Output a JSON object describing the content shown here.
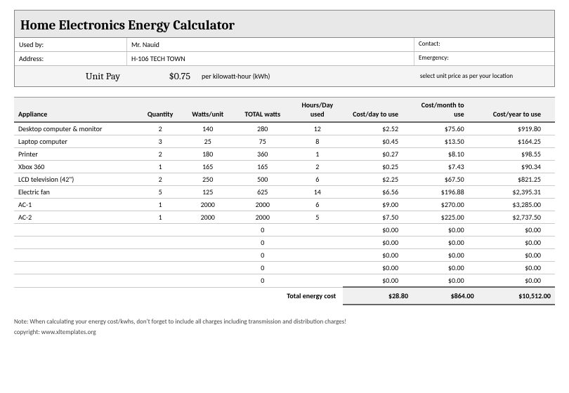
{
  "title": "Home Electronics Energy Calculator",
  "info": {
    "used_by_label": "Used by:",
    "used_by_value": "Mr. Nauid",
    "address_label": "Address:",
    "address_value": "H-106 TECH TOWN",
    "contact_label": "Contact:",
    "emergency_label": "Emergency:"
  },
  "unit_pay": {
    "label": "Unit Pay",
    "value": "$0.75",
    "unit": "per kilowatt-hour (kWh)",
    "note": "select unit price as per your location"
  },
  "columns": {
    "appliance": "Appliance",
    "quantity": "Quantity",
    "watts_unit": "Watts/unit",
    "total_watts": "TOTAL  watts",
    "hours_day": "Hours/Day used",
    "cost_day": "Cost/day to use",
    "cost_month": "Cost/month to use",
    "cost_year": "Cost/year to use"
  },
  "rows": [
    {
      "appliance": "Desktop computer & monitor",
      "quantity": "2",
      "watts_unit": "140",
      "total_watts": "280",
      "hours_day": "12",
      "cost_day": "$2.52",
      "cost_month": "$75.60",
      "cost_year": "$919.80"
    },
    {
      "appliance": "Laptop computer",
      "quantity": "3",
      "watts_unit": "25",
      "total_watts": "75",
      "hours_day": "8",
      "cost_day": "$0.45",
      "cost_month": "$13.50",
      "cost_year": "$164.25"
    },
    {
      "appliance": "Printer",
      "quantity": "2",
      "watts_unit": "180",
      "total_watts": "360",
      "hours_day": "1",
      "cost_day": "$0.27",
      "cost_month": "$8.10",
      "cost_year": "$98.55"
    },
    {
      "appliance": "Xbox 360",
      "quantity": "1",
      "watts_unit": "165",
      "total_watts": "165",
      "hours_day": "2",
      "cost_day": "$0.25",
      "cost_month": "$7.43",
      "cost_year": "$90.34"
    },
    {
      "appliance": "LCD television (42\")",
      "quantity": "2",
      "watts_unit": "250",
      "total_watts": "500",
      "hours_day": "6",
      "cost_day": "$2.25",
      "cost_month": "$67.50",
      "cost_year": "$821.25"
    },
    {
      "appliance": "Electric fan",
      "quantity": "5",
      "watts_unit": "125",
      "total_watts": "625",
      "hours_day": "14",
      "cost_day": "$6.56",
      "cost_month": "$196.88",
      "cost_year": "$2,395.31"
    },
    {
      "appliance": "AC-1",
      "quantity": "1",
      "watts_unit": "2000",
      "total_watts": "2000",
      "hours_day": "6",
      "cost_day": "$9.00",
      "cost_month": "$270.00",
      "cost_year": "$3,285.00"
    },
    {
      "appliance": "AC-2",
      "quantity": "1",
      "watts_unit": "2000",
      "total_watts": "2000",
      "hours_day": "5",
      "cost_day": "$7.50",
      "cost_month": "$225.00",
      "cost_year": "$2,737.50"
    },
    {
      "appliance": "",
      "quantity": "",
      "watts_unit": "",
      "total_watts": "0",
      "hours_day": "",
      "cost_day": "$0.00",
      "cost_month": "$0.00",
      "cost_year": "$0.00"
    },
    {
      "appliance": "",
      "quantity": "",
      "watts_unit": "",
      "total_watts": "0",
      "hours_day": "",
      "cost_day": "$0.00",
      "cost_month": "$0.00",
      "cost_year": "$0.00"
    },
    {
      "appliance": "",
      "quantity": "",
      "watts_unit": "",
      "total_watts": "0",
      "hours_day": "",
      "cost_day": "$0.00",
      "cost_month": "$0.00",
      "cost_year": "$0.00"
    },
    {
      "appliance": "",
      "quantity": "",
      "watts_unit": "",
      "total_watts": "0",
      "hours_day": "",
      "cost_day": "$0.00",
      "cost_month": "$0.00",
      "cost_year": "$0.00"
    },
    {
      "appliance": "",
      "quantity": "",
      "watts_unit": "",
      "total_watts": "0",
      "hours_day": "",
      "cost_day": "$0.00",
      "cost_month": "$0.00",
      "cost_year": "$0.00"
    }
  ],
  "totals": {
    "label": "Total energy cost",
    "cost_day": "$28.80",
    "cost_month": "$864.00",
    "cost_year": "$10,512.00"
  },
  "footer": {
    "note": "Note: When calculating your energy cost/kwhs, don't forget to include all charges including transmission and distribution charges!",
    "copyright": "copyright: www.xltemplates.org"
  }
}
